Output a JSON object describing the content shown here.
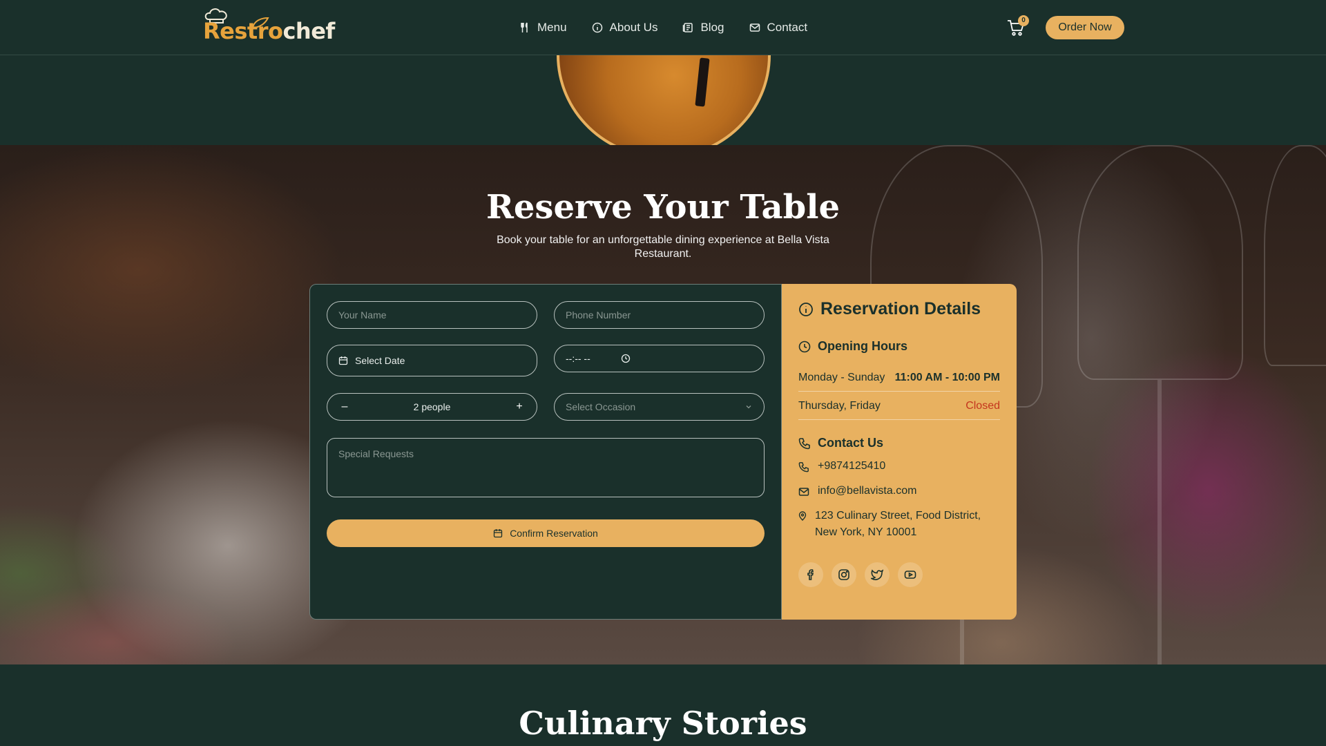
{
  "header": {
    "logo": {
      "part1": "Restro",
      "part2": "chef"
    },
    "nav": [
      {
        "label": "Menu",
        "icon": "utensils-icon"
      },
      {
        "label": "About Us",
        "icon": "info-icon"
      },
      {
        "label": "Blog",
        "icon": "newspaper-icon"
      },
      {
        "label": "Contact",
        "icon": "mail-icon"
      }
    ],
    "cart_count": "0",
    "order_label": "Order Now"
  },
  "reservation": {
    "title": "Reserve Your Table",
    "subtitle": "Book your table for an unforgettable dining experience at Bella Vista Restaurant.",
    "form": {
      "name_placeholder": "Your Name",
      "phone_placeholder": "Phone Number",
      "date_label": "Select Date",
      "time_placeholder": "--:-- --",
      "guests_minus": "–",
      "guests_value": "2 people",
      "guests_plus": "+",
      "occasion_placeholder": "Select Occasion",
      "requests_placeholder": "Special Requests",
      "confirm_label": "Confirm Reservation"
    },
    "details": {
      "title": "Reservation Details",
      "hours_title": "Opening Hours",
      "hours": [
        {
          "days": "Monday - Sunday",
          "time": "11:00 AM - 10:00 PM"
        },
        {
          "days": "Thursday, Friday",
          "time": "Closed"
        }
      ],
      "contact_title": "Contact Us",
      "phone": "+9874125410",
      "email": "info@bellavista.com",
      "address": "123 Culinary Street, Food District, New York, NY 10001",
      "socials": [
        "facebook-icon",
        "instagram-icon",
        "twitter-icon",
        "youtube-icon"
      ]
    }
  },
  "stories": {
    "title": "Culinary Stories"
  },
  "colors": {
    "background": "#1a302b",
    "accent": "#e8b160",
    "closed": "#c4351d"
  }
}
